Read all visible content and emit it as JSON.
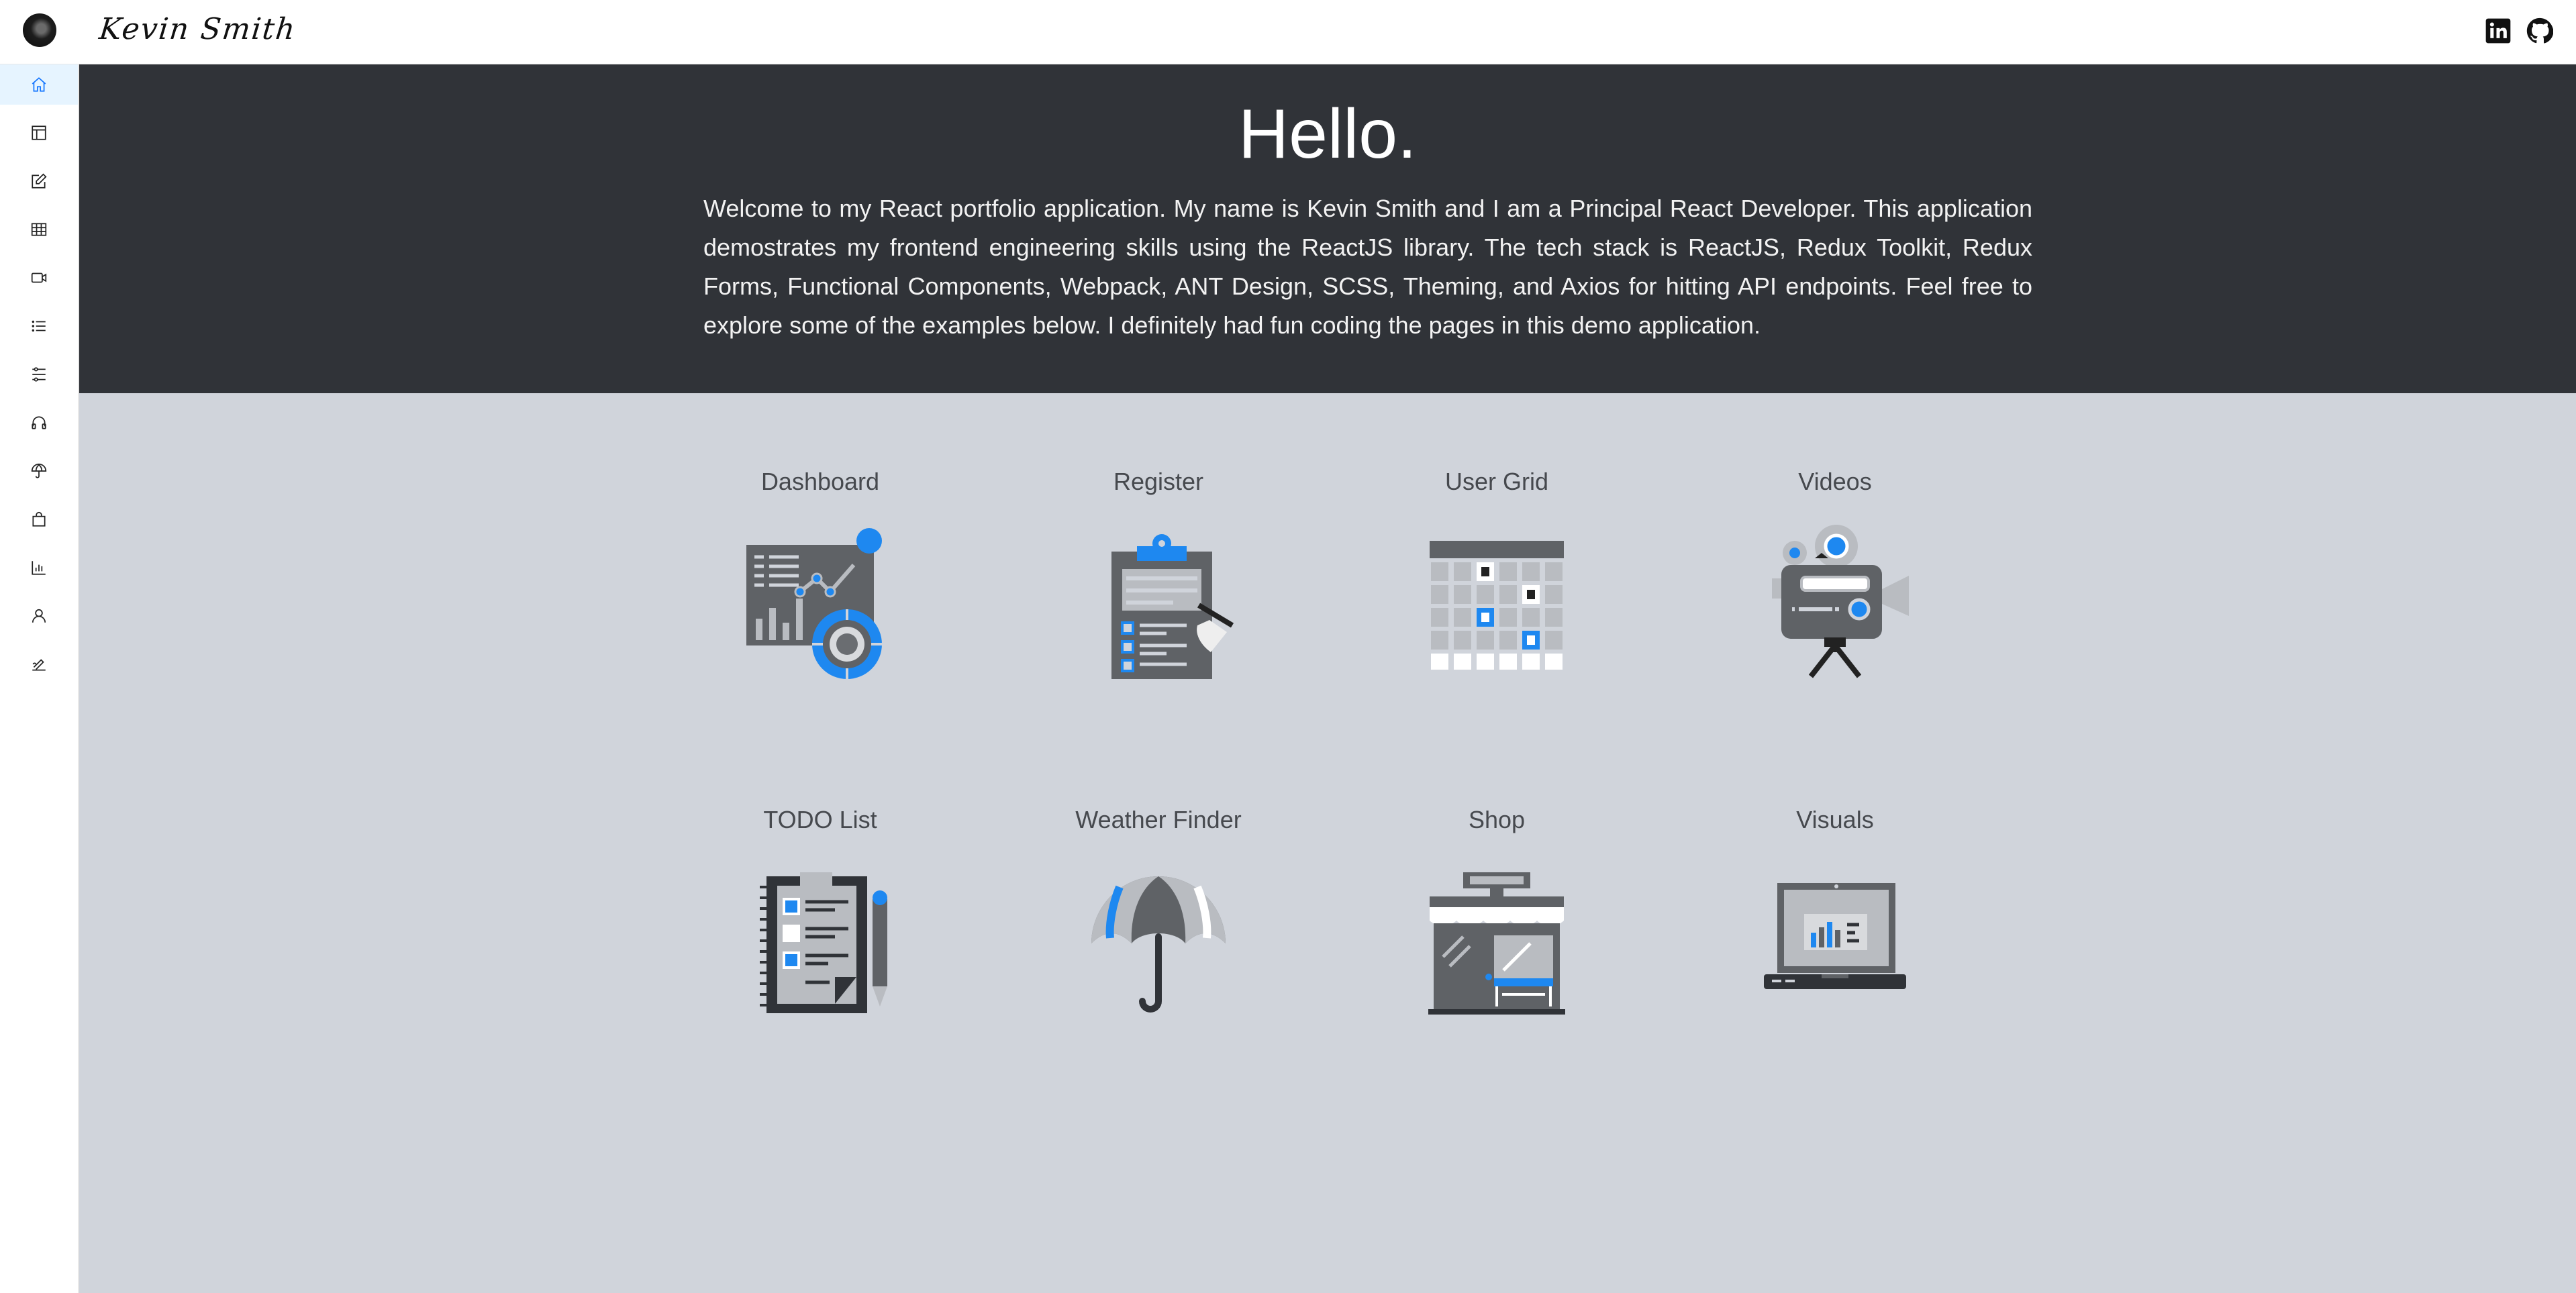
{
  "header": {
    "signature": "Kevin Smith",
    "social": [
      "linkedin-icon",
      "github-icon"
    ]
  },
  "sidebar": {
    "items": [
      {
        "icon": "home-icon",
        "active": true
      },
      {
        "icon": "layout-icon"
      },
      {
        "icon": "edit-form-icon"
      },
      {
        "icon": "table-icon"
      },
      {
        "icon": "video-camera-icon"
      },
      {
        "icon": "list-icon"
      },
      {
        "icon": "sliders-icon"
      },
      {
        "icon": "headphones-icon"
      },
      {
        "icon": "umbrella-icon"
      },
      {
        "icon": "shopping-bag-icon"
      },
      {
        "icon": "bar-chart-icon"
      },
      {
        "icon": "user-icon"
      },
      {
        "icon": "signature-icon"
      }
    ]
  },
  "hero": {
    "title": "Hello.",
    "text": "Welcome to my React portfolio application. My name is Kevin Smith and I am a Principal React Developer. This application demostrates my frontend engineering skills using the ReactJS library. The tech stack is ReactJS, Redux Toolkit, Redux Forms, Functional Components, Webpack, ANT Design, SCSS, Theming, and Axios for hitting API endpoints. Feel free to explore some of the examples below. I definitely had fun coding the pages in this demo application."
  },
  "cards": [
    {
      "label": "Dashboard",
      "icon": "dashboard-icon"
    },
    {
      "label": "Register",
      "icon": "clipboard-icon"
    },
    {
      "label": "User Grid",
      "icon": "grid-icon"
    },
    {
      "label": "Videos",
      "icon": "film-camera-icon"
    },
    {
      "label": "TODO List",
      "icon": "notebook-icon"
    },
    {
      "label": "Weather Finder",
      "icon": "umbrella-icon"
    },
    {
      "label": "Shop",
      "icon": "storefront-icon"
    },
    {
      "label": "Visuals",
      "icon": "laptop-chart-icon"
    }
  ],
  "colors": {
    "accent": "#1e88f0",
    "hero_bg": "#303338",
    "page_bg": "#d0d4db",
    "icon_dark": "#5f6266",
    "icon_light": "#b9bcc1"
  }
}
